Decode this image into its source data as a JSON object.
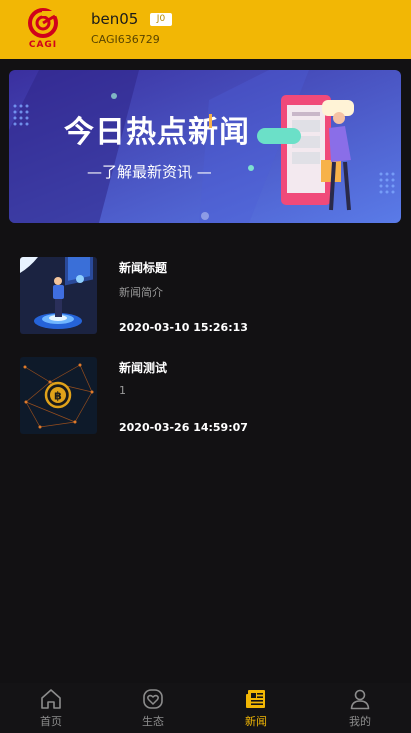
{
  "header": {
    "username": "ben05",
    "level_badge": "J0",
    "user_id": "CAGI636729",
    "logo_text": "CAGI"
  },
  "banner": {
    "headline": "今日热点新闻",
    "subline": "—了解最新资讯 —"
  },
  "news": [
    {
      "title": "新闻标题",
      "summary": "新闻简介",
      "date": "2020-03-10 15:26:13",
      "thumb_icon": "futuristic-screen-person-icon"
    },
    {
      "title": "新闻测试",
      "summary": "1",
      "date": "2020-03-26 14:59:07",
      "thumb_icon": "bitcoin-network-icon"
    }
  ],
  "tabbar": [
    {
      "label": "首页",
      "icon": "home-icon",
      "active": false
    },
    {
      "label": "生态",
      "icon": "heart-badge-icon",
      "active": false
    },
    {
      "label": "新闻",
      "icon": "newspaper-icon",
      "active": true
    },
    {
      "label": "我的",
      "icon": "user-icon",
      "active": false
    }
  ],
  "colors": {
    "accent": "#f2b705",
    "background": "#121113"
  }
}
